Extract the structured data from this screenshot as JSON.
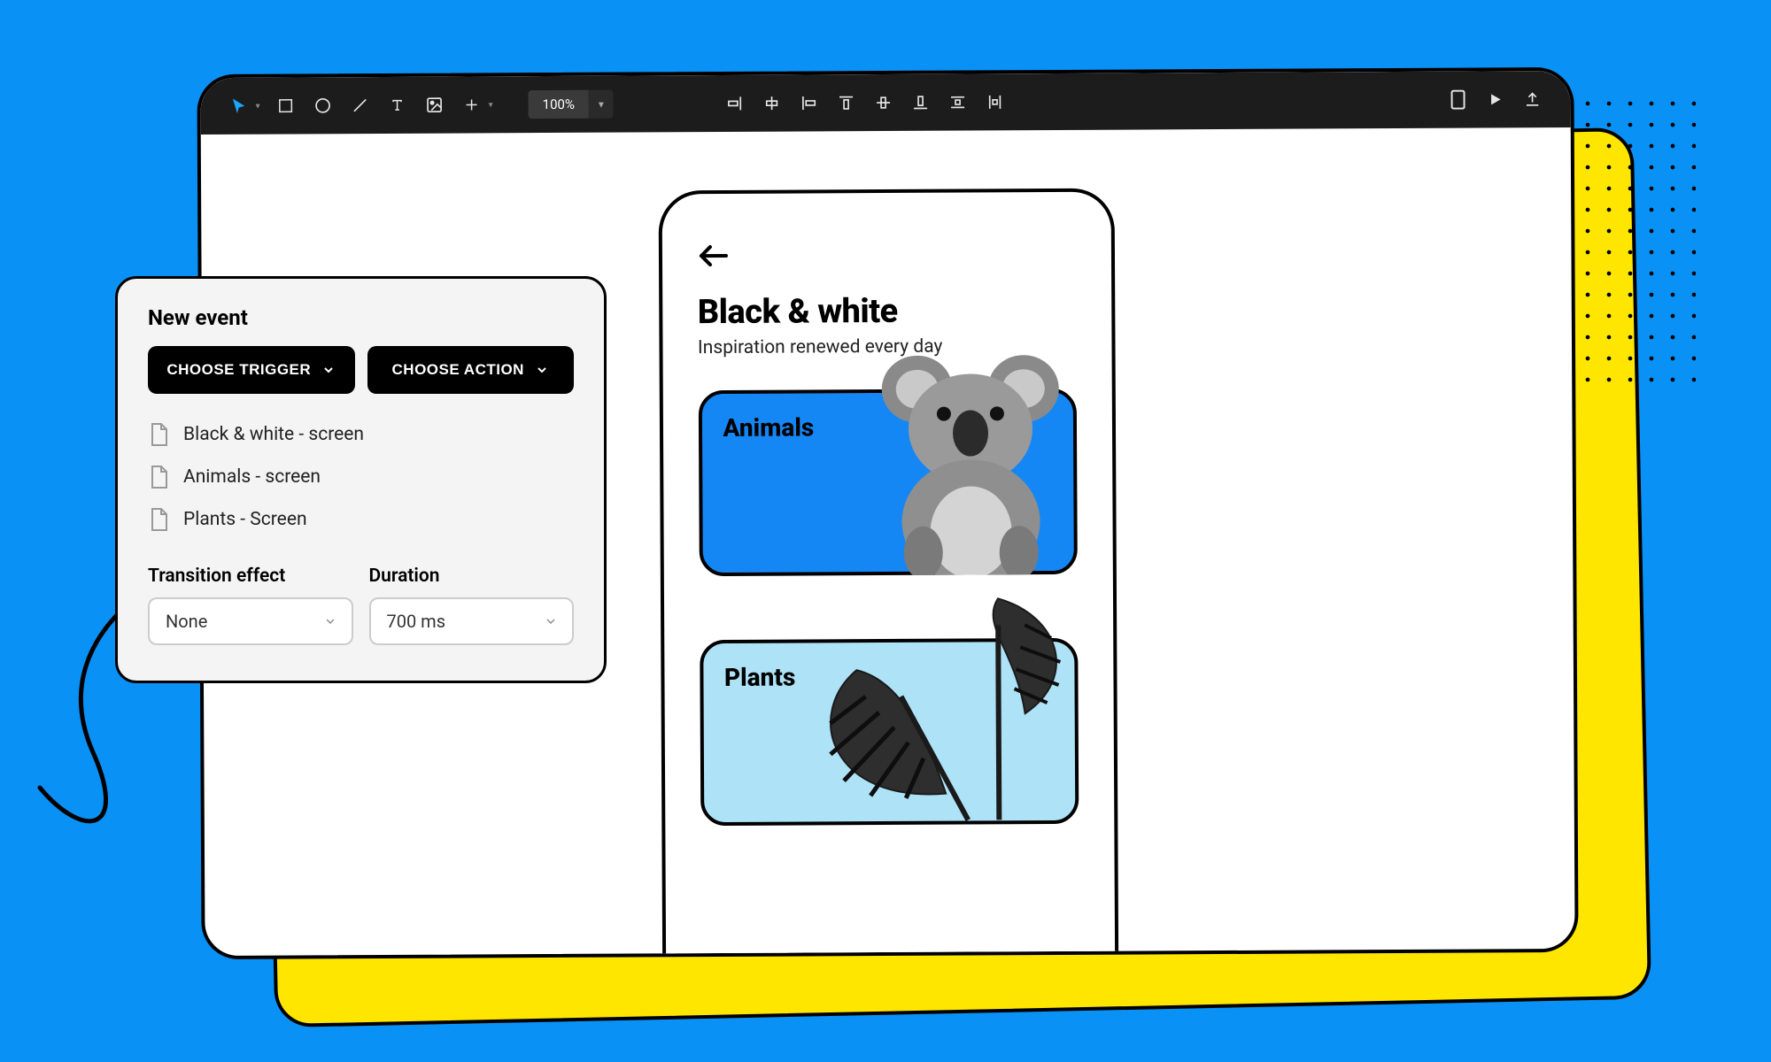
{
  "toolbar": {
    "zoom": "100%"
  },
  "phone": {
    "title": "Black & white",
    "subtitle": "Inspiration renewed every day",
    "card1_label": "Animals",
    "card2_label": "Plants"
  },
  "panel": {
    "title": "New event",
    "trigger_btn": "CHOOSE TRIGGER",
    "action_btn": "CHOOSE ACTION",
    "screens": [
      "Black & white - screen",
      "Animals - screen",
      "Plants - Screen"
    ],
    "effect_label": "Transition effect",
    "effect_value": "None",
    "duration_label": "Duration",
    "duration_value": "700 ms"
  }
}
